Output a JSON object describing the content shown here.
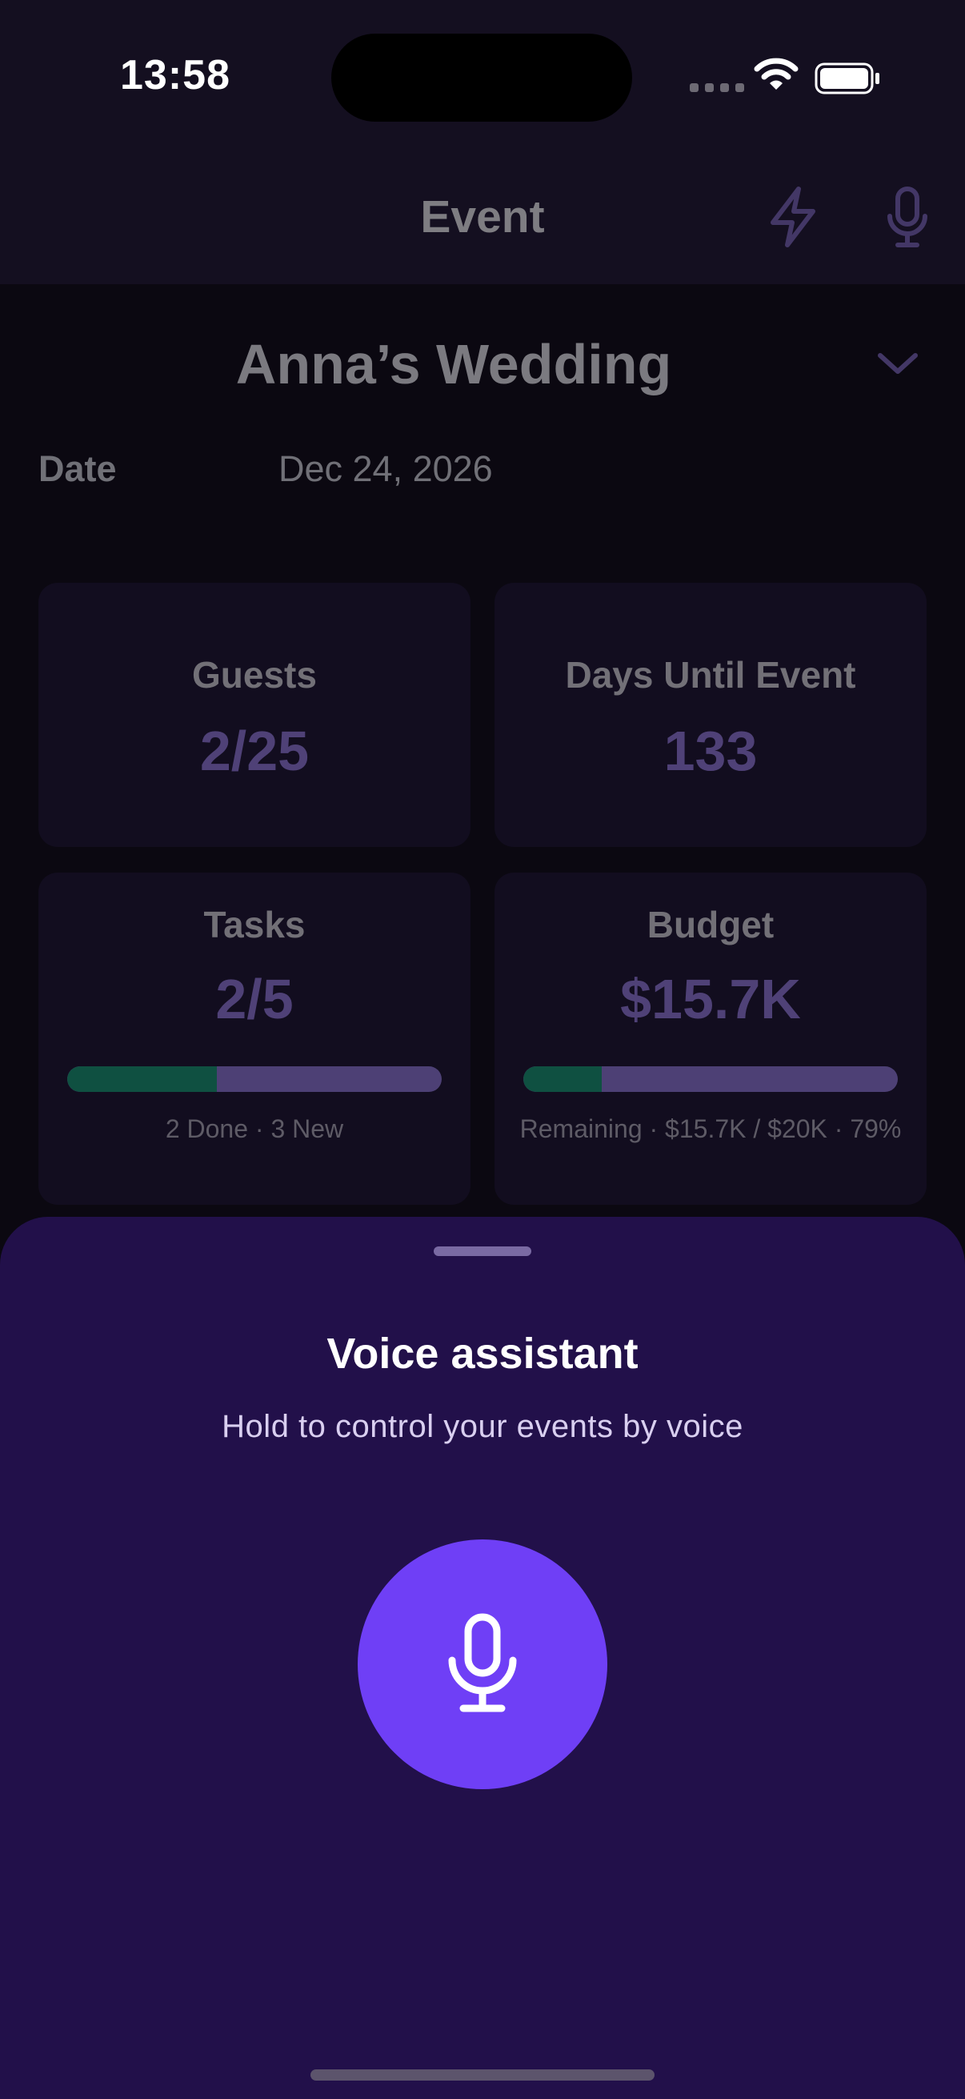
{
  "status_bar": {
    "time": "13:58"
  },
  "app_bar": {
    "title": "Event",
    "icons": [
      "bolt-icon",
      "microphone-icon"
    ]
  },
  "event": {
    "name": "Anna’s Wedding",
    "date_label": "Date",
    "date_value": "Dec 24, 2026"
  },
  "cards": {
    "guests": {
      "label": "Guests",
      "value": "2/25"
    },
    "days": {
      "label": "Days Until Event",
      "value": "133"
    },
    "tasks": {
      "label": "Tasks",
      "value": "2/5",
      "progress": 0.4,
      "summary": "2 Done · 3 New"
    },
    "budget": {
      "label": "Budget",
      "value": "$15.7K",
      "progress": 0.21,
      "summary": "Remaining · $15.7K / $20K · 79%"
    }
  },
  "voice_sheet": {
    "title": "Voice assistant",
    "subtitle": "Hold to control your events by voice"
  },
  "colors": {
    "accent": "#6f3ff6",
    "sheet_bg": "#22104a",
    "progress_done": "#0f5041",
    "progress_rest": "#4d4075"
  }
}
